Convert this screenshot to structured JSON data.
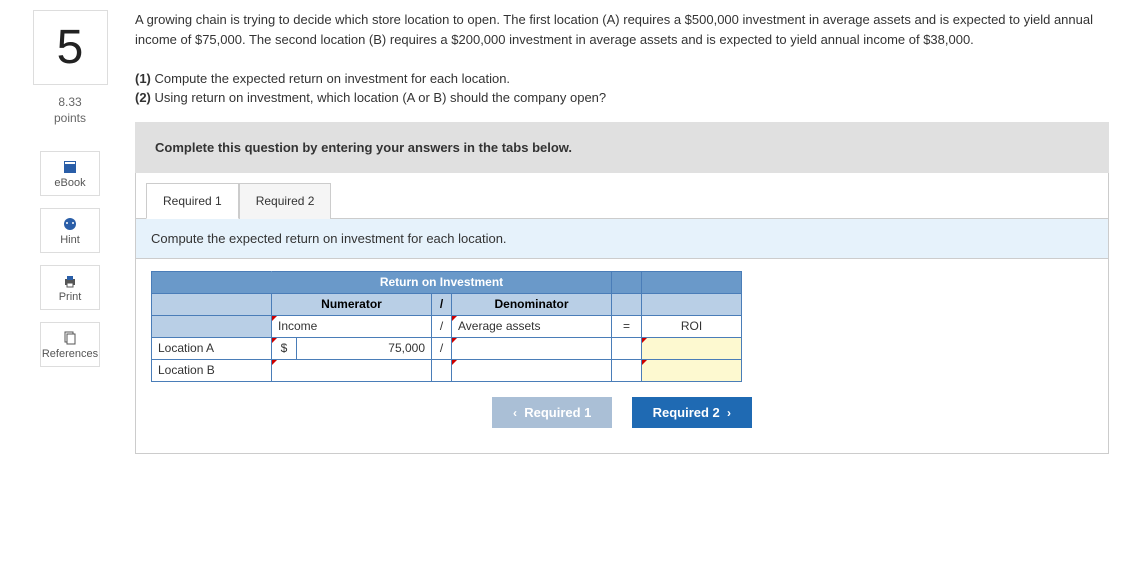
{
  "question": {
    "number": "5",
    "points_value": "8.33",
    "points_label": "points",
    "body_para": "A growing chain is trying to decide which store location to open. The first location (A) requires a $500,000 investment in average assets and is expected to yield annual income of $75,000. The second location (B) requires a $200,000 investment in average assets and is expected to yield annual income of $38,000.",
    "sub1_bold": "(1)",
    "sub1_text": " Compute the expected return on investment for each location.",
    "sub2_bold": "(2)",
    "sub2_text": " Using return on investment, which location (A or B) should the company open?"
  },
  "sidebar": {
    "ebook": "eBook",
    "hint": "Hint",
    "print": "Print",
    "references": "References"
  },
  "answer_area": {
    "instruction": "Complete this question by entering your answers in the tabs below.",
    "tabs": {
      "req1": "Required 1",
      "req2": "Required 2"
    },
    "sub_instruction": "Compute the expected return on investment for each location."
  },
  "table": {
    "title": "Return on Investment",
    "numerator": "Numerator",
    "divider": "/",
    "denominator": "Denominator",
    "income": "Income",
    "avg_assets": "Average assets",
    "equals": "=",
    "roi": "ROI",
    "loc_a": "Location A",
    "loc_b": "Location B",
    "currency": "$",
    "value_a_num": "75,000",
    "value_a_den": "",
    "value_a_roi": "",
    "value_b_num": "",
    "value_b_den": "",
    "value_b_roi": ""
  },
  "nav": {
    "prev_label": "Required 1",
    "next_label": "Required 2"
  }
}
